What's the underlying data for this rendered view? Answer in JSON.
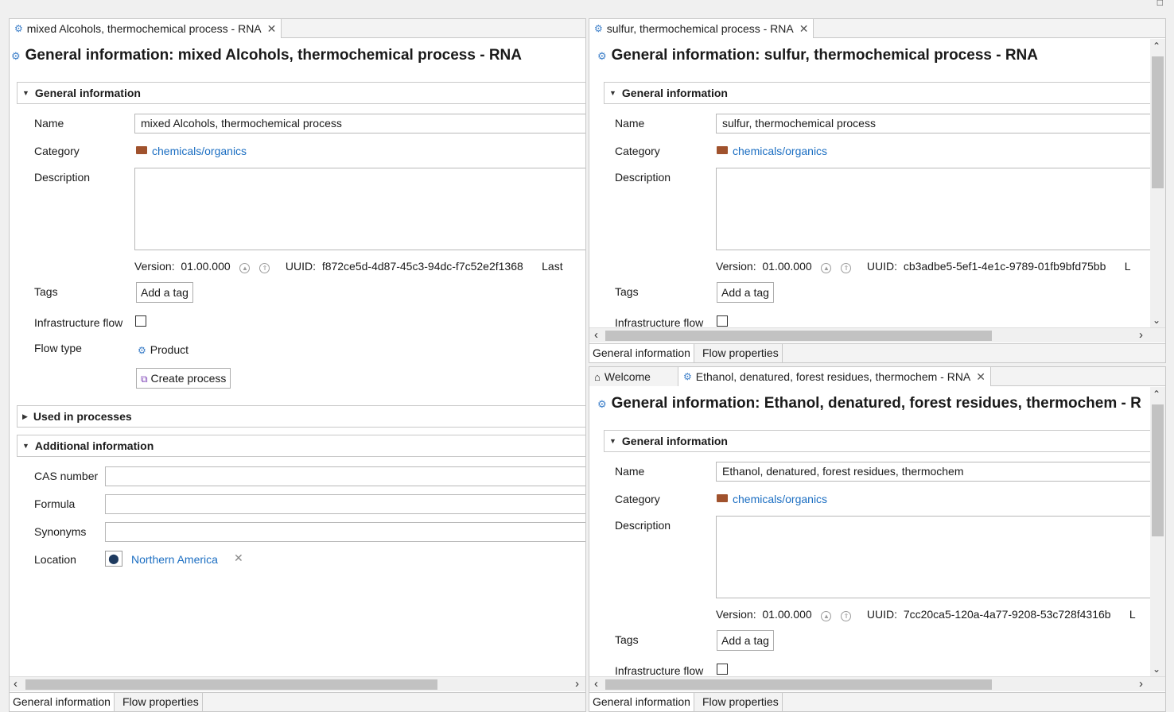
{
  "window": {
    "restore_glyph": "□"
  },
  "left": {
    "tab_title": "mixed Alcohols, thermochemical process - RNA",
    "page_title": "General information: mixed Alcohols, thermochemical process - RNA",
    "section_general": "General information",
    "name_label": "Name",
    "name_value": "mixed Alcohols, thermochemical process",
    "category_label": "Category",
    "category_value": "chemicals/organics",
    "description_label": "Description",
    "version_label": "Version:",
    "version_value": "01.00.000",
    "uuid_label": "UUID:",
    "uuid_value": "f872ce5d-4d87-45c3-94dc-f7c52e2f1368",
    "last_label": "Last",
    "tags_label": "Tags",
    "add_tag": "Add a tag",
    "infra_label": "Infrastructure flow",
    "flow_type_label": "Flow type",
    "flow_type_value": "Product",
    "create_process": "Create process",
    "section_used": "Used in processes",
    "section_additional": "Additional information",
    "cas_label": "CAS number",
    "formula_label": "Formula",
    "synonyms_label": "Synonyms",
    "location_label": "Location",
    "location_value": "Northern America",
    "bottom_tab_1": "General information",
    "bottom_tab_2": "Flow properties"
  },
  "top_right": {
    "tab_title": "sulfur, thermochemical process - RNA",
    "page_title": "General information: sulfur, thermochemical process - RNA",
    "section_general": "General information",
    "name_label": "Name",
    "name_value": "sulfur, thermochemical process",
    "category_label": "Category",
    "category_value": "chemicals/organics",
    "description_label": "Description",
    "version_label": "Version:",
    "version_value": "01.00.000",
    "uuid_label": "UUID:",
    "uuid_value": "cb3adbe5-5ef1-4e1c-9789-01fb9bfd75bb",
    "last_label": "L",
    "tags_label": "Tags",
    "add_tag": "Add a tag",
    "infra_label": "Infrastructure flow",
    "bottom_tab_1": "General information",
    "bottom_tab_2": "Flow properties"
  },
  "bottom_right": {
    "welcome_tab": "Welcome",
    "tab_title": "Ethanol, denatured, forest residues, thermochem - RNA",
    "page_title": "General information: Ethanol, denatured, forest residues, thermochem - R",
    "section_general": "General information",
    "name_label": "Name",
    "name_value": "Ethanol, denatured, forest residues, thermochem",
    "category_label": "Category",
    "category_value": "chemicals/organics",
    "description_label": "Description",
    "version_label": "Version:",
    "version_value": "01.00.000",
    "uuid_label": "UUID:",
    "uuid_value": "7cc20ca5-120a-4a77-9208-53c728f4316b",
    "last_label": "L",
    "tags_label": "Tags",
    "add_tag": "Add a tag",
    "infra_label": "Infrastructure flow",
    "bottom_tab_1": "General information",
    "bottom_tab_2": "Flow properties"
  },
  "colors": {
    "link": "#1b6ec2",
    "folder": "#a0522d",
    "gear": "#3d7fc9"
  },
  "icons": [
    "gear-icon",
    "close-icon",
    "folder-icon",
    "home-icon",
    "location-pin-icon",
    "create-process-icon",
    "twistie-icon"
  ]
}
